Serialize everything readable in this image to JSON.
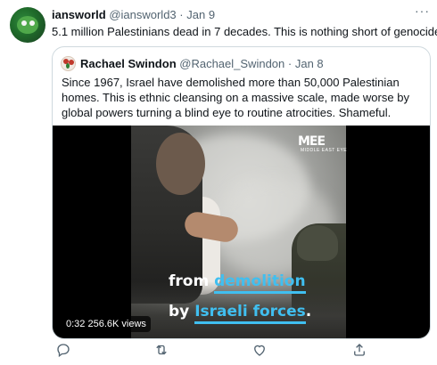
{
  "tweet": {
    "author_name": "iansworld",
    "author_handle": "@iansworld3",
    "separator": "·",
    "date": "Jan 9",
    "more_label": "···",
    "text": "5.1 million Palestinians dead in 7 decades. This is nothing short of genocide."
  },
  "quoted_tweet": {
    "author_name": "Rachael Swindon",
    "author_handle": "@Rachael_Swindon",
    "separator": "·",
    "date": "Jan 8",
    "text": "Since 1967, Israel have demolished more than 50,000 Palestinian homes. This is ethnic cleansing on a massive scale, made worse by global powers turning a blind eye to routine atrocities. Shameful."
  },
  "video": {
    "logo_text": "MEE",
    "logo_subtext": "MIDDLE EAST EYE",
    "caption_line1_white": "from",
    "caption_line1_blue": "demolition",
    "caption_line2_white": "by",
    "caption_line2_blue": "Israeli forces",
    "caption_line2_end": ".",
    "duration": "0:32",
    "views": "256.6K views"
  },
  "actions": [
    "reply-icon",
    "retweet-icon",
    "like-icon",
    "share-icon"
  ],
  "colors": {
    "text_primary": "#0f1419",
    "text_secondary": "#536471",
    "border": "#cfd9de",
    "caption_accent": "#40bff0"
  }
}
